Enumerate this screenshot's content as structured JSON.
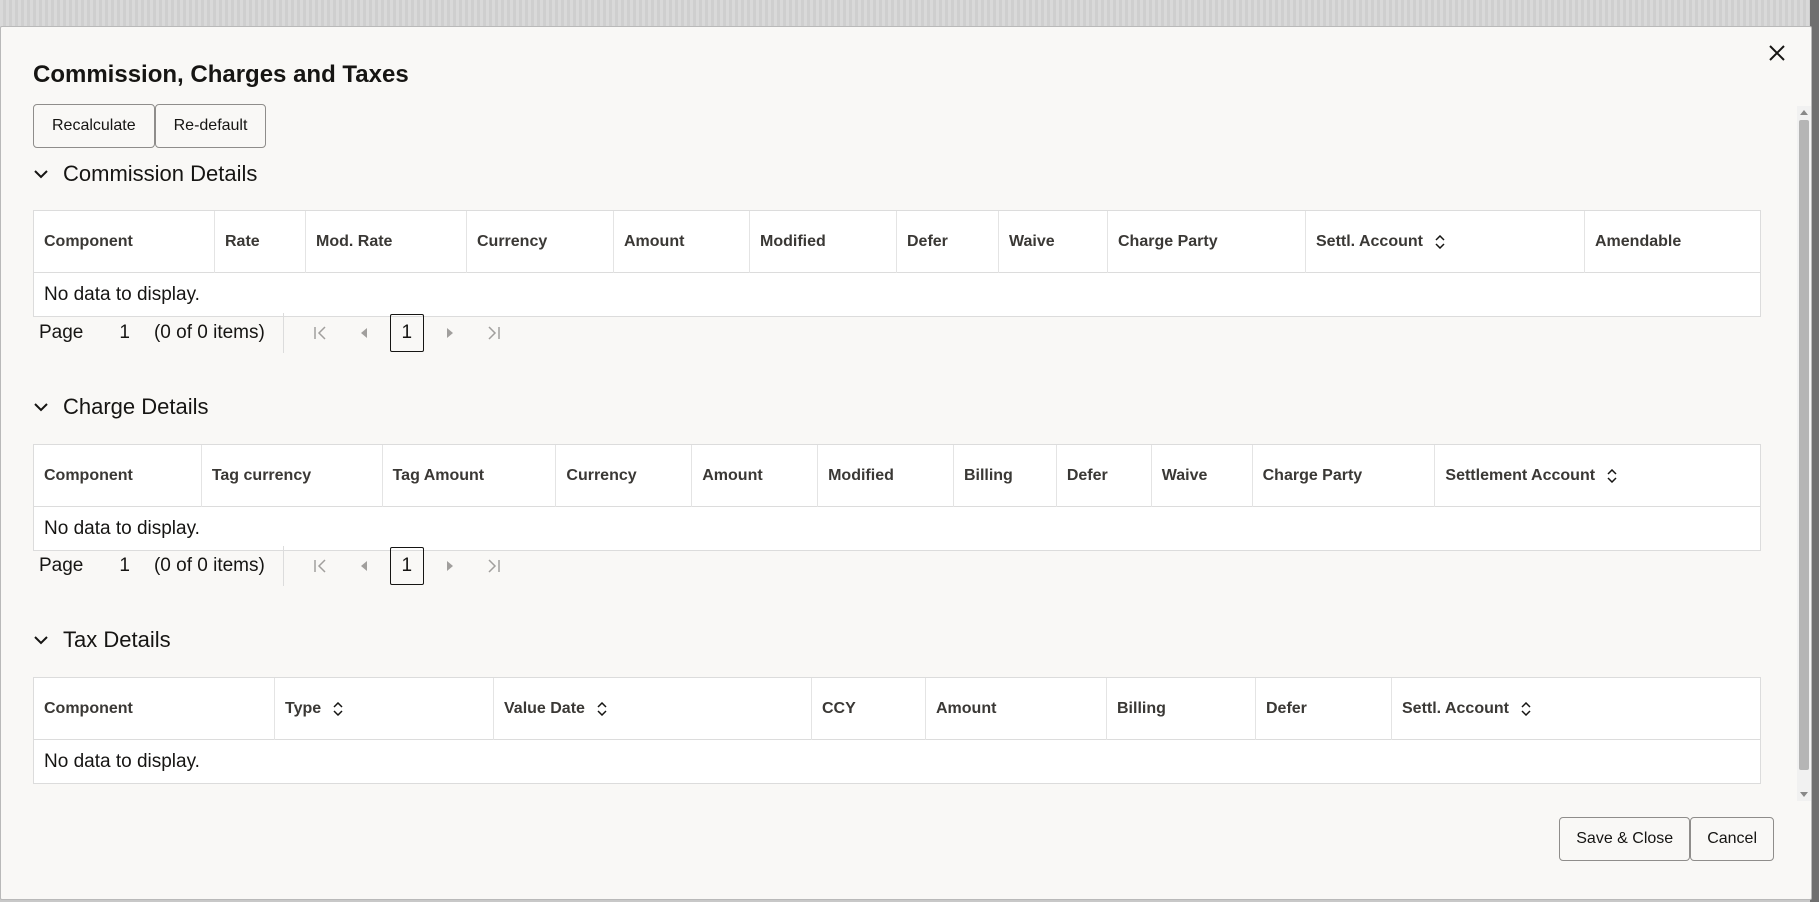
{
  "dialog": {
    "title": "Commission, Charges and Taxes",
    "recalculate_label": "Recalculate",
    "redefault_label": "Re-default",
    "save_close_label": "Save & Close",
    "cancel_label": "Cancel",
    "close_icon": "close-icon"
  },
  "commission": {
    "title": "Commission Details",
    "columns": [
      "Component",
      "Rate",
      "Mod. Rate",
      "Currency",
      "Amount",
      "Modified",
      "Defer",
      "Waive",
      "Charge Party",
      "Settl. Account",
      "Amendable"
    ],
    "sortable_column": "Settl. Account",
    "no_data": "No data to display.",
    "pager": {
      "page_label": "Page",
      "page": "1",
      "count": "(0 of 0 items)",
      "current": "1"
    }
  },
  "charge": {
    "title": "Charge Details",
    "columns": [
      "Component",
      "Tag currency",
      "Tag Amount",
      "Currency",
      "Amount",
      "Modified",
      "Billing",
      "Defer",
      "Waive",
      "Charge Party",
      "Settlement Account"
    ],
    "sortable_column": "Settlement Account",
    "no_data": "No data to display.",
    "pager": {
      "page_label": "Page",
      "page": "1",
      "count": "(0 of 0 items)",
      "current": "1"
    }
  },
  "tax": {
    "title": "Tax Details",
    "columns": [
      "Component",
      "Type",
      "Value Date",
      "CCY",
      "Amount",
      "Billing",
      "Defer",
      "Settl. Account"
    ],
    "sortable_columns": [
      "Type",
      "Value Date",
      "Settl. Account"
    ],
    "no_data": "No data to display."
  },
  "icons": {
    "collapse": "chevron-down-icon",
    "sort": "sort-icon",
    "first": "first-page-icon",
    "prev": "previous-page-icon",
    "next": "next-page-icon",
    "last": "last-page-icon"
  },
  "colors": {
    "dialog_bg": "#f9f8f6",
    "text": "#161513",
    "border": "#dcdcdc"
  }
}
